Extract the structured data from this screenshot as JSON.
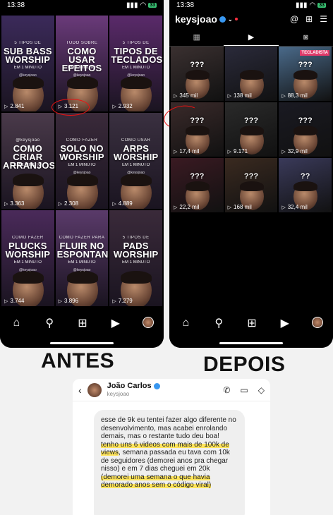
{
  "before": {
    "time": "13:38",
    "battery": "33",
    "tiles": [
      {
        "top": "5 TIPOS DE",
        "headline": "SUB BASS WORSHIP",
        "sub": "EM 1 MINUTO",
        "handle": "@keysjoao",
        "views": "2.841",
        "bg": "#3b2a5a"
      },
      {
        "top": "TUDO SOBRE",
        "headline": "COMO USAR EFEITOS",
        "sub": "EM 1 MINUTO",
        "handle": "@keysjoao",
        "views": "3.121",
        "bg": "#6a3a7a"
      },
      {
        "top": "5 TIPOS DE",
        "headline": "TIPOS DE TECLADOS",
        "sub": "EM 1 MINUTO",
        "handle": "@keysjoao",
        "views": "2.932",
        "bg": "#5a2a6a"
      },
      {
        "top": "@keysjoao",
        "headline": "COMO CRIAR ARRANJOS",
        "sub": "EM 1 MINUTO",
        "handle": "",
        "views": "3.363",
        "bg": "#4a3a4a"
      },
      {
        "top": "COMO FAZER",
        "headline": "SOLO NO WORSHIP",
        "sub": "EM 1 MINUTO",
        "handle": "@keysjoao",
        "views": "2.308",
        "bg": "#3a2a3a"
      },
      {
        "top": "COMO USAR",
        "headline": "ARPS WORSHIP",
        "sub": "EM 1 MINUTO",
        "handle": "@keysjoao",
        "views": "4.889",
        "bg": "#3a3040"
      },
      {
        "top": "COMO FAZER",
        "headline": "PLUCKS WORSHIP",
        "sub": "EM 1 MINUTO",
        "handle": "@keysjoao",
        "views": "3.744",
        "bg": "#4a2a5a"
      },
      {
        "top": "COMO FAZER PARA",
        "headline": "FLUIR NO ESPONTANEO",
        "sub": "EM 1 MINUTO",
        "handle": "@keysjoao",
        "views": "3.896",
        "bg": "#5a3a6a"
      },
      {
        "top": "5 TIPOS DE",
        "headline": "PADS WORSHIP",
        "sub": "EM 1 MINUTO",
        "handle": "",
        "views": "7.279",
        "bg": "#3a2a3a"
      }
    ]
  },
  "after": {
    "time": "13:38",
    "battery": "33",
    "username": "keysjoao",
    "tiles": [
      {
        "views": "345 mil",
        "q": "???",
        "bg": "#3a3030",
        "badge": ""
      },
      {
        "views": "138 mil",
        "q": "",
        "bg": "#2a2a3a",
        "badge": ""
      },
      {
        "views": "88,3 mil",
        "q": "???",
        "bg": "#4a6a8a",
        "badge": "TECLADISTA"
      },
      {
        "views": "17,4 mil",
        "q": "???",
        "bg": "#3a2a2a",
        "badge": ""
      },
      {
        "views": "9.171",
        "q": "???",
        "bg": "#2a2a2a",
        "badge": ""
      },
      {
        "views": "32,9 mil",
        "q": "???",
        "bg": "#1a1a22",
        "badge": ""
      },
      {
        "views": "22,2 mil",
        "q": "???",
        "bg": "#3a1a22",
        "badge": ""
      },
      {
        "views": "168 mil",
        "q": "???",
        "bg": "#3a2a20",
        "badge": ""
      },
      {
        "views": "32,4 mil",
        "q": "??",
        "bg": "#3a3a5a",
        "badge": ""
      }
    ]
  },
  "captions": {
    "antes": "ANTES",
    "depois": "DEPOIS"
  },
  "chat": {
    "name": "João Carlos",
    "username": "keysjoao",
    "msg_a": "esse de 9k eu tentei fazer algo diferente no desenvolvimento, mas acabei enrolando demais, mas o restante tudo deu boa! ",
    "msg_b": "tenho uns 6 videos com mais de 100k de views",
    "msg_c": ", semana passada eu tava com 10k de seguidores (demorei anos pra chegar nisso) e em 7 dias cheguei em 20k ",
    "msg_d": "(demorei uma semana o que havia demorado anos sem o código viral)"
  },
  "colors": {
    "highlight": "#ffe45c",
    "circle": "#e11111",
    "verified": "#3897f0"
  }
}
